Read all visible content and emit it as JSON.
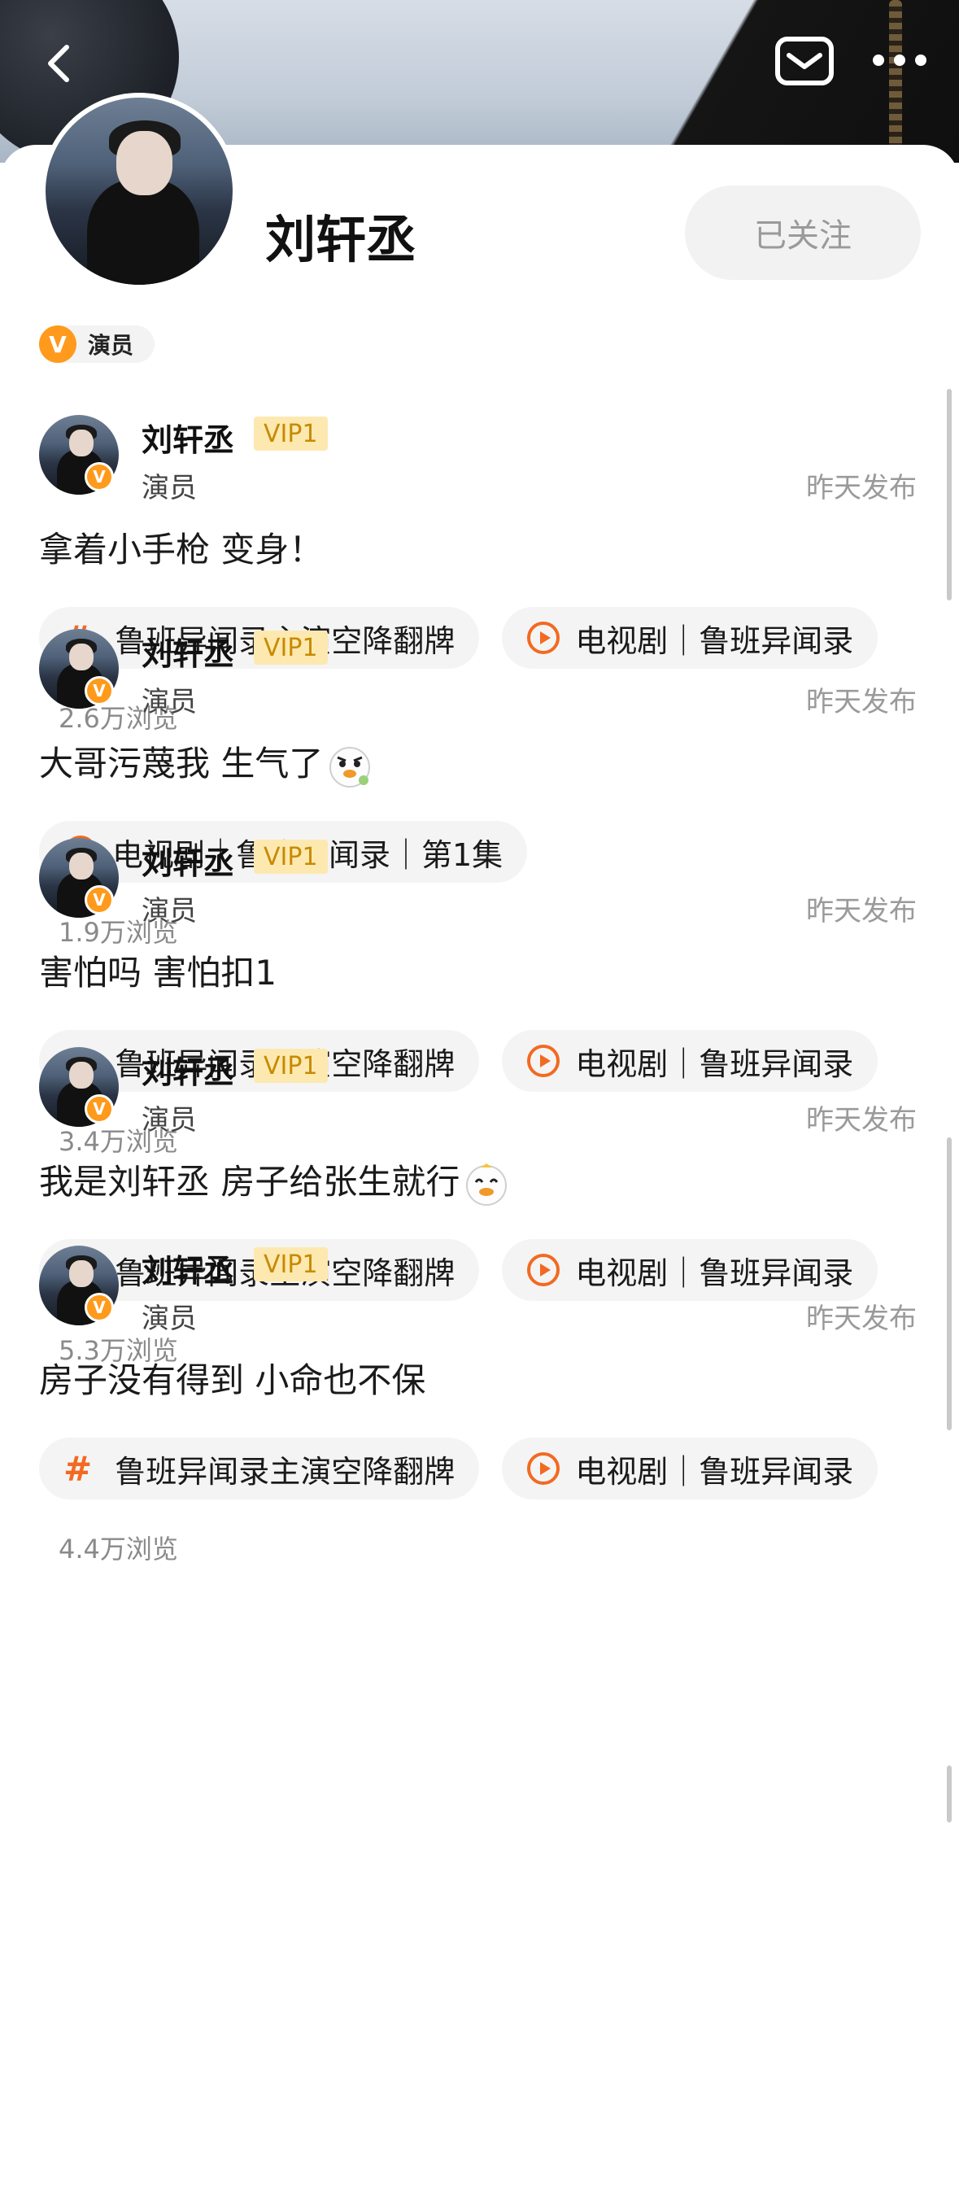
{
  "profile": {
    "name": "刘轩丞",
    "follow_label": "已关注",
    "role_badge_icon": "V",
    "role": "演员"
  },
  "posts": [
    {
      "author": "刘轩丞",
      "vip": "VIP1",
      "role": "演员",
      "time": "昨天发布",
      "text": "拿着小手枪 变身！",
      "emoji": "",
      "tags": [
        {
          "type": "topic",
          "label": "鲁班异闻录主演空降翻牌"
        },
        {
          "type": "video",
          "label": "电视剧｜鲁班异闻录"
        }
      ],
      "views": "2.6万浏览"
    },
    {
      "author": "刘轩丞",
      "vip": "VIP1",
      "role": "演员",
      "time": "昨天发布",
      "text": "大哥污蔑我 生气了",
      "emoji": "angry-duck-emoji",
      "tags": [
        {
          "type": "video",
          "label": "电视剧｜鲁班异闻录｜第1集"
        }
      ],
      "views": "1.9万浏览"
    },
    {
      "author": "刘轩丞",
      "vip": "VIP1",
      "role": "演员",
      "time": "昨天发布",
      "text": "害怕吗 害怕扣1",
      "emoji": "",
      "tags": [
        {
          "type": "topic",
          "label": "鲁班异闻录主演空降翻牌"
        },
        {
          "type": "video",
          "label": "电视剧｜鲁班异闻录"
        }
      ],
      "views": "3.4万浏览"
    },
    {
      "author": "刘轩丞",
      "vip": "VIP1",
      "role": "演员",
      "time": "昨天发布",
      "text": "我是刘轩丞 房子给张生就行",
      "emoji": "happy-duck-emoji",
      "tags": [
        {
          "type": "topic",
          "label": "鲁班异闻录主演空降翻牌"
        },
        {
          "type": "video",
          "label": "电视剧｜鲁班异闻录"
        }
      ],
      "views": "5.3万浏览"
    },
    {
      "author": "刘轩丞",
      "vip": "VIP1",
      "role": "演员",
      "time": "昨天发布",
      "text": "房子没有得到 小命也不保",
      "emoji": "",
      "tags": [
        {
          "type": "topic",
          "label": "鲁班异闻录主演空降翻牌"
        },
        {
          "type": "video",
          "label": "电视剧｜鲁班异闻录"
        }
      ],
      "views": "4.4万浏览"
    }
  ],
  "icons": {
    "back": "chevron-left-icon",
    "mail": "mail-icon",
    "more": "more-dots-icon",
    "topic": "hashtag-icon",
    "video": "play-circle-icon"
  },
  "colors": {
    "accent": "#f26a21",
    "verified": "#ff9a1c",
    "vip_bg": "#fde9b0",
    "vip_text": "#c88a00"
  }
}
